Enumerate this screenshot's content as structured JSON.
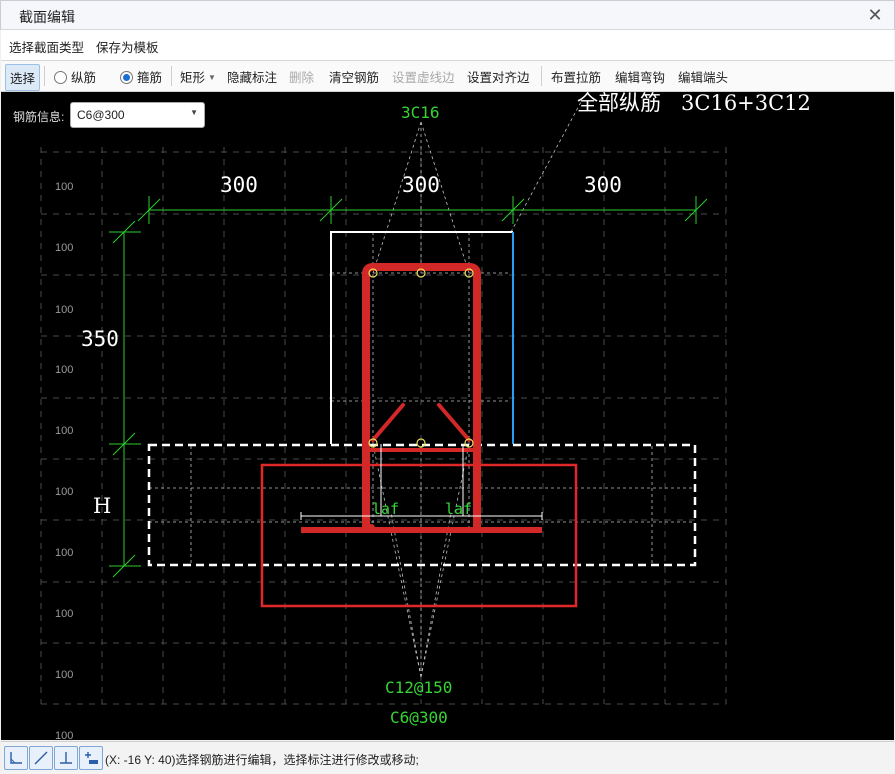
{
  "window": {
    "title": "截面编辑",
    "close_glyph": "✕"
  },
  "menu": {
    "items": [
      "选择截面类型",
      "保存为模板"
    ]
  },
  "toolbar": {
    "select": "选择",
    "radio_longitudinal": "纵筋",
    "radio_stirrup": "箍筋",
    "shape": "矩形",
    "hide_annotation": "隐藏标注",
    "delete": "删除",
    "clear_rebar": "清空钢筋",
    "set_dashed_edge": "设置虚线边",
    "set_align_edge": "设置对齐边",
    "place_tie": "布置拉筋",
    "edit_hook": "编辑弯钩",
    "edit_end": "编辑端头"
  },
  "rebar_info": {
    "label": "钢筋信息:",
    "value": "C6@300"
  },
  "drawing": {
    "top_rebar_label": "3C16",
    "all_longitudinal": "全部纵筋   3C16+3C12",
    "dim_top": [
      "300",
      "300",
      "300"
    ],
    "dim_left_upper": "350",
    "dim_left_lower": "H",
    "grid_labels": [
      "100",
      "100",
      "100",
      "100",
      "100",
      "100",
      "100",
      "100",
      "100",
      "100"
    ],
    "anchor_left": "laf",
    "anchor_right": "laf",
    "bottom_label_1": "C12@150",
    "bottom_label_2": "C6@300",
    "colors": {
      "rebar": "#d22828",
      "dim": "#2ecc2e",
      "outline": "#ffffff",
      "edge_blue": "#2a9df4",
      "label_green": "#35d535"
    }
  },
  "statusbar": {
    "icons": [
      "ortho-snap-icon",
      "line-icon",
      "perpendicular-icon",
      "add-point-icon"
    ],
    "coord": "(X: -16 Y: 40)",
    "hint": "选择钢筋进行编辑，选择标注进行修改或移动;"
  }
}
